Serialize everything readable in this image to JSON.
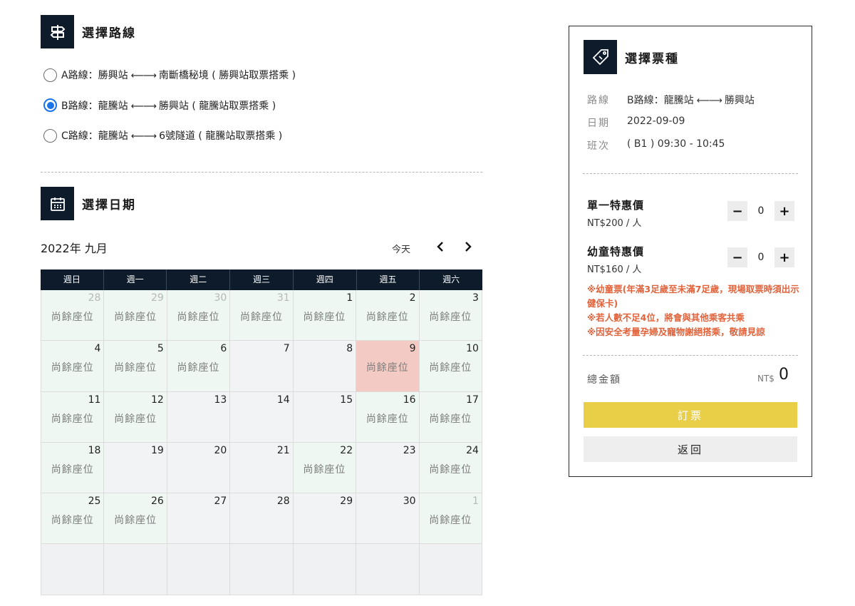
{
  "route_section": {
    "title": "選擇路線",
    "icon": "route-sign-icon",
    "options": [
      {
        "prefix": "A路線：勝興站",
        "arrow": "⟵⟶",
        "suffix": "南斷橋秘境 ( 勝興站取票搭乘 )",
        "checked": false
      },
      {
        "prefix": "B路線：龍騰站",
        "arrow": "⟵⟶",
        "suffix": "勝興站 ( 龍騰站取票搭乘 )",
        "checked": true
      },
      {
        "prefix": "C路線：龍騰站",
        "arrow": "⟵⟶",
        "suffix": "6號隧道 ( 龍騰站取票搭乘 )",
        "checked": false
      }
    ]
  },
  "date_section": {
    "title": "選擇日期",
    "icon": "calendar-icon",
    "month_title": "2022年 九月",
    "today_label": "今天",
    "prev_icon": "chevron-left-icon",
    "next_icon": "chevron-right-icon",
    "weekdays": [
      "週日",
      "週一",
      "週二",
      "週三",
      "週四",
      "週五",
      "週六"
    ],
    "status_text": "尚餘座位",
    "weeks": [
      [
        {
          "day": "28",
          "muted": true,
          "avail": true
        },
        {
          "day": "29",
          "muted": true,
          "avail": true
        },
        {
          "day": "30",
          "muted": true,
          "avail": true
        },
        {
          "day": "31",
          "muted": true,
          "avail": true
        },
        {
          "day": "1",
          "avail": true
        },
        {
          "day": "2",
          "avail": true
        },
        {
          "day": "3",
          "avail": true
        }
      ],
      [
        {
          "day": "4",
          "avail": true
        },
        {
          "day": "5",
          "avail": true
        },
        {
          "day": "6",
          "avail": true
        },
        {
          "day": "7",
          "avail": false
        },
        {
          "day": "8",
          "avail": false
        },
        {
          "day": "9",
          "avail": true,
          "selected": true
        },
        {
          "day": "10",
          "avail": true
        }
      ],
      [
        {
          "day": "11",
          "avail": true
        },
        {
          "day": "12",
          "avail": true
        },
        {
          "day": "13",
          "avail": false
        },
        {
          "day": "14",
          "avail": false
        },
        {
          "day": "15",
          "avail": false
        },
        {
          "day": "16",
          "avail": true
        },
        {
          "day": "17",
          "avail": true
        }
      ],
      [
        {
          "day": "18",
          "avail": true
        },
        {
          "day": "19",
          "avail": false
        },
        {
          "day": "20",
          "avail": false
        },
        {
          "day": "21",
          "avail": false
        },
        {
          "day": "22",
          "avail": true
        },
        {
          "day": "23",
          "avail": false
        },
        {
          "day": "24",
          "avail": true
        }
      ],
      [
        {
          "day": "25",
          "avail": true
        },
        {
          "day": "26",
          "avail": true
        },
        {
          "day": "27",
          "avail": false
        },
        {
          "day": "28",
          "avail": false
        },
        {
          "day": "29",
          "avail": false
        },
        {
          "day": "30",
          "avail": false
        },
        {
          "day": "1",
          "muted": true,
          "avail": true
        }
      ],
      [
        {
          "day": "",
          "empty": true
        },
        {
          "day": "",
          "empty": true
        },
        {
          "day": "",
          "empty": true
        },
        {
          "day": "",
          "empty": true
        },
        {
          "day": "",
          "empty": true
        },
        {
          "day": "",
          "empty": true
        },
        {
          "day": "",
          "empty": true
        }
      ]
    ]
  },
  "ticket_panel": {
    "title": "選擇票種",
    "icon": "ticket-tag-icon",
    "summary": {
      "route_label": "路線",
      "route_prefix": "B路線：龍騰站",
      "route_arrow": "⟵⟶",
      "route_suffix": "勝興站",
      "date_label": "日期",
      "date_value": "2022-09-09",
      "trip_label": "班次",
      "trip_value": "( B1 ) 09:30 - 10:45"
    },
    "tickets": [
      {
        "name": "單一特惠價",
        "price": "NT$200 / 人",
        "quantity": "0"
      },
      {
        "name": "幼童特惠價",
        "price": "NT$160 / 人",
        "quantity": "0"
      }
    ],
    "notes": [
      "※幼童票(年滿3足歲至未滿7足歲，現場取票時須出示健保卡)",
      "※若人數不足4位，將會與其他乘客共乘",
      "※因安全考量孕婦及寵物謝絕搭乘，敬請見諒"
    ],
    "total_label": "總金額",
    "total_currency": "NT$",
    "total_value": "0",
    "book_label": "訂票",
    "back_label": "返回"
  },
  "colors": {
    "dark_navy": "#0d1b2a",
    "available_cell": "#eef7f1",
    "selected_cell": "#f3cbc4",
    "unavailable_cell": "#f2f3f4",
    "radio_accent": "#1a73e8",
    "notes_red": "#e0633c",
    "book_yellow": "#e9cf47"
  }
}
